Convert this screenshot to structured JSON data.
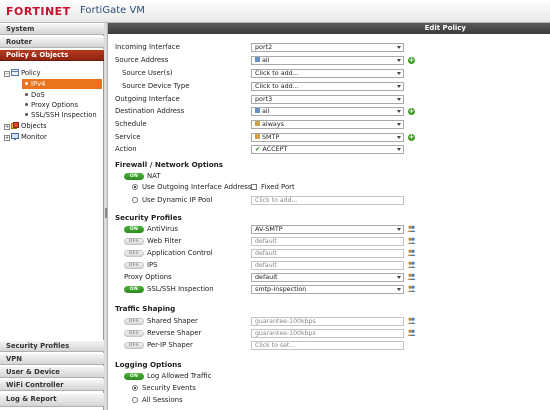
{
  "header": {
    "brand": "FORTINET",
    "product": "FortiGate VM"
  },
  "sidebar": {
    "top_sections": [
      "System",
      "Router",
      "Policy & Objects"
    ],
    "tree": {
      "policy": "Policy",
      "ipv4": "IPv4",
      "dos": "DoS",
      "proxy_options": "Proxy Options",
      "ssl_inspection": "SSL/SSH Inspection",
      "objects": "Objects",
      "monitor": "Monitor"
    },
    "bottom_sections": [
      "Security Profiles",
      "VPN",
      "User & Device",
      "WiFi Controller",
      "Log & Report"
    ]
  },
  "edit_policy": {
    "title": "Edit Policy",
    "incoming_interface": {
      "label": "Incoming Interface",
      "value": "port2"
    },
    "source_address": {
      "label": "Source Address",
      "value": "all"
    },
    "source_users": {
      "label": "Source User(s)",
      "value": "Click to add..."
    },
    "source_device_type": {
      "label": "Source Device Type",
      "value": "Click to add..."
    },
    "outgoing_interface": {
      "label": "Outgoing Interface",
      "value": "port3"
    },
    "destination_address": {
      "label": "Destination Address",
      "value": "all"
    },
    "schedule": {
      "label": "Schedule",
      "value": "always"
    },
    "service": {
      "label": "Service",
      "value": "SMTP"
    },
    "action": {
      "label": "Action",
      "value": "ACCEPT"
    }
  },
  "firewall_network": {
    "title": "Firewall / Network Options",
    "nat_label": "NAT",
    "nat_state": "ON",
    "use_outgoing": "Use Outgoing Interface Address",
    "fixed_port": "Fixed Port",
    "use_dynamic": "Use Dynamic IP Pool",
    "dynamic_placeholder": "Click to add..."
  },
  "security_profiles": {
    "title": "Security Profiles",
    "antivirus": {
      "label": "AntiVirus",
      "state": "ON",
      "value": "AV-SMTP"
    },
    "web_filter": {
      "label": "Web Filter",
      "state": "OFF",
      "value": "default"
    },
    "app_control": {
      "label": "Application Control",
      "state": "OFF",
      "value": "default"
    },
    "ips": {
      "label": "IPS",
      "state": "OFF",
      "value": "default"
    },
    "proxy_options": {
      "label": "Proxy Options",
      "value": "default"
    },
    "ssl_ssh": {
      "label": "SSL/SSH Inspection",
      "state": "ON",
      "value": "smtp-inspection"
    }
  },
  "traffic_shaping": {
    "title": "Traffic Shaping",
    "shared": {
      "label": "Shared Shaper",
      "state": "OFF",
      "value": "guarantee-100kbps"
    },
    "reverse": {
      "label": "Reverse Shaper",
      "state": "OFF",
      "value": "guarantee-100kbps"
    },
    "per_ip": {
      "label": "Per-IP Shaper",
      "state": "OFF",
      "value": "Click to set..."
    }
  },
  "logging": {
    "title": "Logging Options",
    "log_allowed": {
      "label": "Log Allowed Traffic",
      "state": "ON"
    },
    "security_events": "Security Events",
    "all_sessions": "All Sessions"
  },
  "colors": {
    "accent": "#b53a1e",
    "tree_selected": "#e8741e",
    "toggle_on": "#3a9a1e",
    "brand_red": "#c8102e"
  }
}
